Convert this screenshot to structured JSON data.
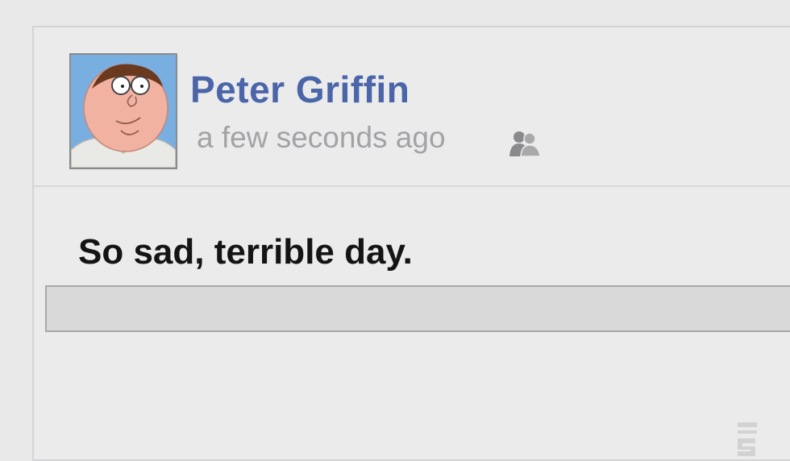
{
  "post": {
    "author": "Peter Griffin",
    "timestamp": "a few seconds ago",
    "status": "So sad, terrible day.",
    "privacy_icon": "friends-icon",
    "avatar_icon": "user-avatar"
  },
  "colors": {
    "author_link": "#4a65a8",
    "timestamp": "#a3a3a6",
    "card_background": "#ebebec",
    "comment_bar": "#d9d9da"
  }
}
